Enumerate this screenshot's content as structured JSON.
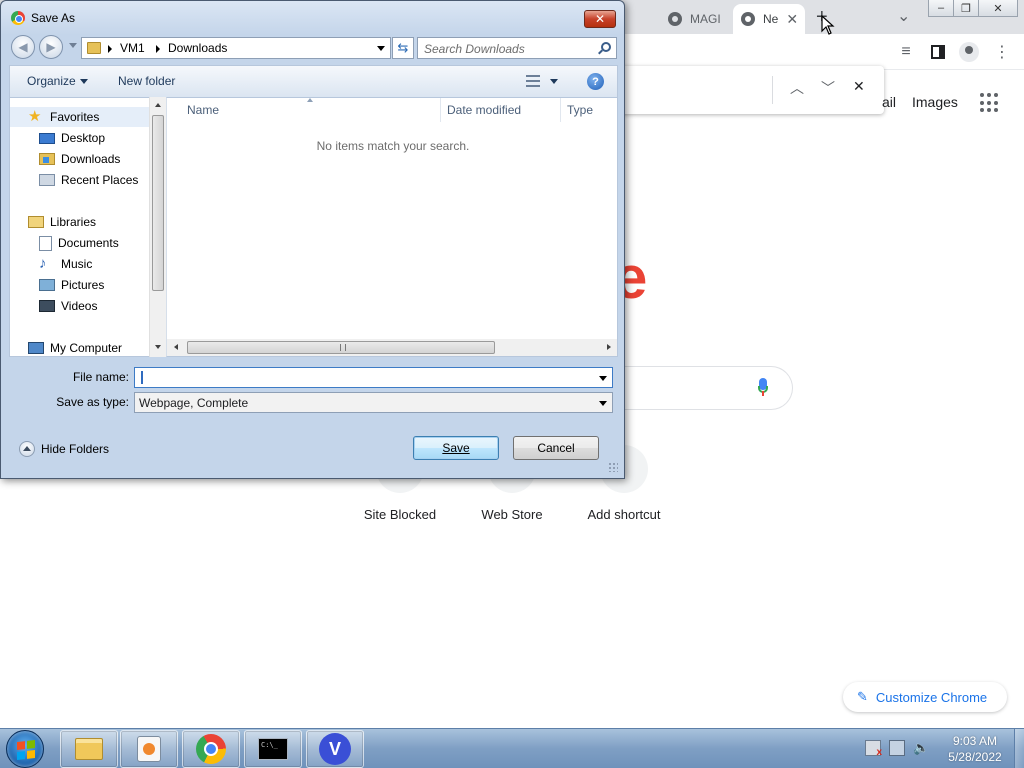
{
  "chrome": {
    "tabs": [
      {
        "label": "MAGI"
      },
      {
        "label": "Ne",
        "close": "✕"
      }
    ],
    "new_tab": "+",
    "tab_menu": "⌄",
    "findbar": {
      "prev": "︿",
      "next": "﹀",
      "close": "✕"
    },
    "links": {
      "gmail": "ail",
      "images": "Images"
    },
    "logo_letter": "e",
    "shortcuts": [
      {
        "label": "Site Blocked"
      },
      {
        "label": "Web Store"
      },
      {
        "label": "Add shortcut"
      }
    ],
    "customize_label": "Customize Chrome"
  },
  "dialog": {
    "title": "Save As",
    "close": "✕",
    "breadcrumb": [
      "VM1",
      "Downloads"
    ],
    "search_placeholder": "Search Downloads",
    "organize": "Organize",
    "new_folder": "New folder",
    "help": "?",
    "nav": {
      "favorites": "Favorites",
      "desktop": "Desktop",
      "downloads": "Downloads",
      "recent": "Recent Places",
      "libraries": "Libraries",
      "documents": "Documents",
      "music": "Music",
      "pictures": "Pictures",
      "videos": "Videos",
      "computer": "My Computer"
    },
    "columns": {
      "name": "Name",
      "date": "Date modified",
      "type": "Type"
    },
    "empty_message": "No items match your search.",
    "file_name_label": "File name:",
    "file_name_value": "",
    "save_type_label": "Save as type:",
    "save_type_value": "Webpage, Complete",
    "hide_folders": "Hide Folders",
    "save": "Save",
    "cancel": "Cancel"
  },
  "taskbar": {
    "cmd_text": "C:\\_",
    "v_label": "V",
    "time": "9:03 AM",
    "date": "5/28/2022"
  }
}
